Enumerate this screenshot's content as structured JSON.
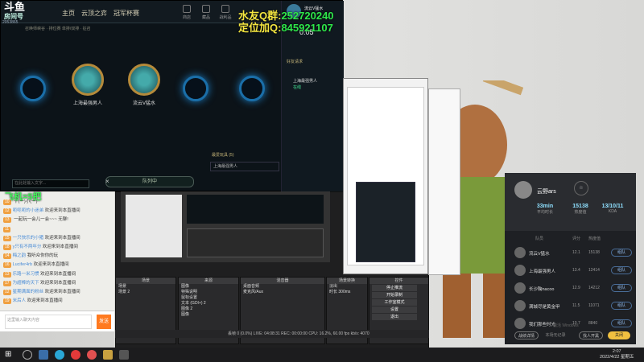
{
  "app": {
    "logo_main": "斗鱼",
    "logo_sub": "房间号",
    "room_id": "2053865"
  },
  "game": {
    "nav": [
      "主页",
      "云顶之弈",
      "冠军杯赛"
    ],
    "top_icons": [
      "商店",
      "藏品",
      "战利品",
      "生涯"
    ],
    "breadcrumb": "召唤师峡谷 · 排位赛 单排/双排 · 征召",
    "slots": [
      "",
      "上海最强男人",
      "流云V猛水",
      "",
      ""
    ],
    "position_select": "最爱玩具 (5)",
    "queue_label": "队列中",
    "sidebar": {
      "user": "流云V猛水",
      "timer": "0:05",
      "group": "好友请求",
      "friend": "上海最强男人",
      "friend_status": "在线"
    },
    "input_placeholder": "在此处输入文字..."
  },
  "overlay": {
    "line1_label": "水友Q群:",
    "line1_value": "252720240",
    "line2_label": "定位加Q:",
    "line2_value": "845921107",
    "banner": "飞机=5把"
  },
  "chat": {
    "messages": [
      {
        "level": "10",
        "name": "",
        "text": "十(一)小(一)"
      },
      {
        "level": "12",
        "name": "呃呃呃的小迷弟",
        "text": "欢迎来到本直播间"
      },
      {
        "level": "13",
        "name": "",
        "text": "一起玩一会儿一会~~~ 无聊!"
      },
      {
        "level": "11",
        "name": "",
        "text": ""
      },
      {
        "level": "15",
        "name": "一只快乐的小猪",
        "text": "欢迎来到本直播间"
      },
      {
        "level": "18",
        "name": "y只有不两年分",
        "text": "欢迎来到本直播间"
      },
      {
        "level": "14",
        "name": "梅之韵",
        "text": "我听众你你的玩"
      },
      {
        "level": "16",
        "name": "Lucifer4rb",
        "text": "欢迎来到本直播间"
      },
      {
        "level": "13",
        "name": "乐路一米习惯",
        "text": "欢迎来到本直播间"
      },
      {
        "level": "17",
        "name": "为超棒的天下",
        "text": "欢迎来到本直播间"
      },
      {
        "level": "12",
        "name": "星期满面的粉丝",
        "text": "欢迎来到本直播间"
      },
      {
        "level": "19",
        "name": "米后人",
        "text": "欢迎来到本直播间"
      }
    ],
    "input_placeholder": "这里输入聊天内容",
    "send": "发送"
  },
  "obs": {
    "docks": [
      {
        "title": "场景",
        "rows": [
          "场景",
          "场景 2"
        ]
      },
      {
        "title": "来源",
        "rows": [
          "图像",
          "特殊说明",
          "鼠标设置",
          "文本 (GDI+) 2",
          "图像 2",
          "图像"
        ]
      },
      {
        "title": "混音器",
        "rows": [
          "桌面音频",
          "麦克风/Aux"
        ]
      },
      {
        "title": "场景转换",
        "rows": [
          "淡出",
          "时长 300ms"
        ]
      },
      {
        "title": "控件",
        "rows": [
          "停止推流",
          "开始录制",
          "工作室模式",
          "设置",
          "退出"
        ]
      }
    ],
    "status": "丢帧 0 (0.0%)    LIVE: 04:08:31    REC: 00:00:00    CPU: 16.2%, 60.00 fps    kb/s: 4070"
  },
  "team": {
    "name": "云野ars",
    "stats": [
      {
        "value": "33min",
        "label": "平均时长"
      },
      {
        "value": "15138",
        "label": "热度值"
      },
      {
        "value": "13/10/11",
        "label": "KDA"
      }
    ],
    "columns": [
      "队员",
      "评分",
      "热度值"
    ],
    "rows": [
      {
        "name": "流云V猛水",
        "score": "12.1",
        "heat": "15138",
        "btn": "组队"
      },
      {
        "name": "上海最强男人",
        "score": "13.4",
        "heat": "12414",
        "btn": "组队"
      },
      {
        "name": "长沙鞠nacoo",
        "score": "12.9",
        "heat": "14212",
        "btn": "组队"
      },
      {
        "name": "满城尽是黄金甲",
        "score": "11.5",
        "heat": "11071",
        "btn": "组队"
      },
      {
        "name": "我们那些时光",
        "score": "10.7",
        "heat": "8840",
        "btn": "组队"
      }
    ],
    "footer": [
      "战绩详情",
      "本场无记录",
      "找人开黑",
      "关闭"
    ],
    "activate": "激活 Windows"
  },
  "taskbar": {
    "time": "2:07",
    "date": "2022/4/22 星期五"
  }
}
